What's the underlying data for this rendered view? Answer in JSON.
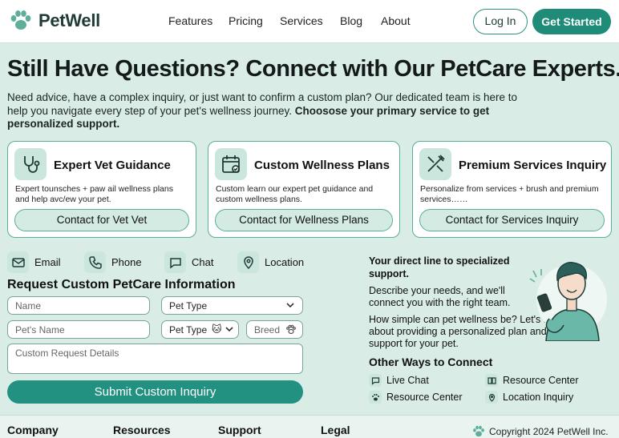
{
  "brand": {
    "name": "PetWell",
    "accent": "#1e8c79",
    "light": "#cbe6dd"
  },
  "nav": {
    "links": [
      "Features",
      "Pricing",
      "Services",
      "Blog",
      "About"
    ],
    "login": "Log In",
    "get_started": "Get Started"
  },
  "hero": {
    "title": "Still Have Questions? Connect with Our PetCare Experts.",
    "subtitle": "Need advice, have a complex inquiry, or just want to confirm a custom plan? Our dedicated team is here to help you navigate every step of your pet's wellness journey.",
    "subtitle_bold": "Choosose your primary service to get personalized support."
  },
  "cards": [
    {
      "icon": "stethoscope-icon",
      "title": "Expert Vet Guidance",
      "desc": "Expert tounsches + paw ail wellness plans and help avc/ew your pet.",
      "button": "Contact for Vet Vet"
    },
    {
      "icon": "calendar-icon",
      "title": "Custom Wellness Plans",
      "desc": "Custom learn our expert pet guidance and custom wellness plans.",
      "button": "Contact for Wellness Plans"
    },
    {
      "icon": "grooming-tools-icon",
      "title": "Premium Services Inquiry",
      "desc": "Personalize from services + brush and premium services……",
      "button": "Contact for Services Inquiry"
    }
  ],
  "channels": [
    {
      "icon": "email-icon",
      "label": "Email"
    },
    {
      "icon": "phone-icon",
      "label": "Phone"
    },
    {
      "icon": "chat-icon",
      "label": "Chat"
    },
    {
      "icon": "location-icon",
      "label": "Location"
    }
  ],
  "form": {
    "title": "Request Custom PetCare Information",
    "name_placeholder": "Name",
    "pet_type": "Pet Type",
    "pets_name_placeholder": "Pet's Name",
    "pet_type_2": "Pet Type",
    "breed_placeholder": "Breed",
    "details_placeholder": "Custom Request Details",
    "submit": "Submit Custom Inquiry"
  },
  "side": {
    "headline": "Your direct line to specialized support.",
    "p1": "Describe your needs, and we'll connect you with the right team.",
    "p2": "How simple can pet wellness be? Let's talk about providing a personalized plan and support for your pet.",
    "other_title": "Other Ways to Connect",
    "other": [
      {
        "icon": "chat-bubble-icon",
        "label": "Live Chat"
      },
      {
        "icon": "book-icon",
        "label": "Resource Center"
      },
      {
        "icon": "paw-icon",
        "label": "Resource Center"
      },
      {
        "icon": "location-pin-icon",
        "label": "Location Inquiry"
      }
    ]
  },
  "footer": {
    "columns": [
      "Company",
      "Resources",
      "Support",
      "Legal"
    ],
    "copyright": "Copyright 2024 PetWell Inc."
  }
}
